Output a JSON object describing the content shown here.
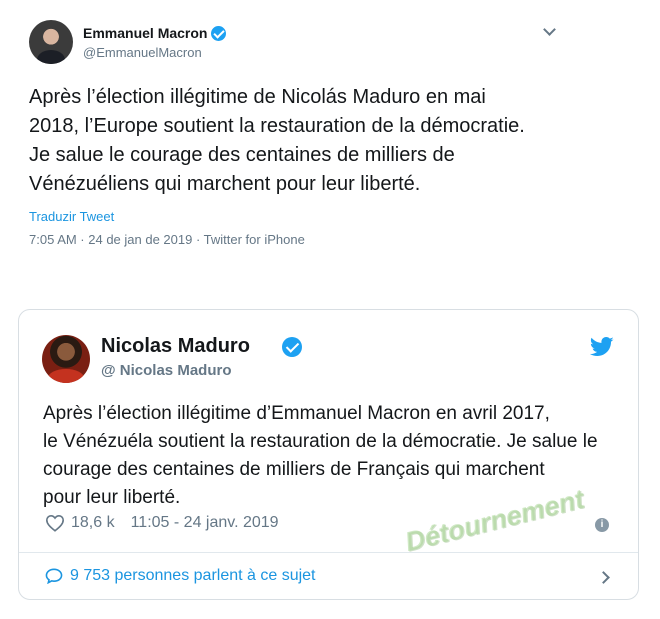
{
  "tweet1": {
    "name": "Emmanuel Macron",
    "handle": "@EmmanuelMacron",
    "lines": [
      "Après l’élection illégitime de Nicolás Maduro en mai",
      "2018, l’Europe soutient la restauration de la démocratie.",
      "Je salue le courage des centaines de milliers de",
      "Vénézuéliens qui marchent pour leur liberté."
    ],
    "translate_label": "Traduzir Tweet",
    "meta": "7:05 AM · 24 de jan de 2019 · Twitter for iPhone"
  },
  "tweet2": {
    "name": "Nicolas Maduro",
    "handle": "@ Nicolas Maduro",
    "lines": [
      "Après l’élection illégitime d’Emmanuel Macron en avril 2017,",
      "le Vénézuéla  soutient la restauration de la démocratie. Je salue le",
      "courage des centaines de milliers de Français qui marchent",
      "pour leur liberté."
    ],
    "likes": "18,6 k",
    "timestamp": "11:05 - 24 janv. 2019",
    "info_icon": "i",
    "footer_text": "9 753 personnes parlent à ce sujet"
  },
  "watermark": "Détournement",
  "colors": {
    "link": "#1b95e0",
    "verified": "#1da1f2",
    "secondary_text": "#657786"
  }
}
